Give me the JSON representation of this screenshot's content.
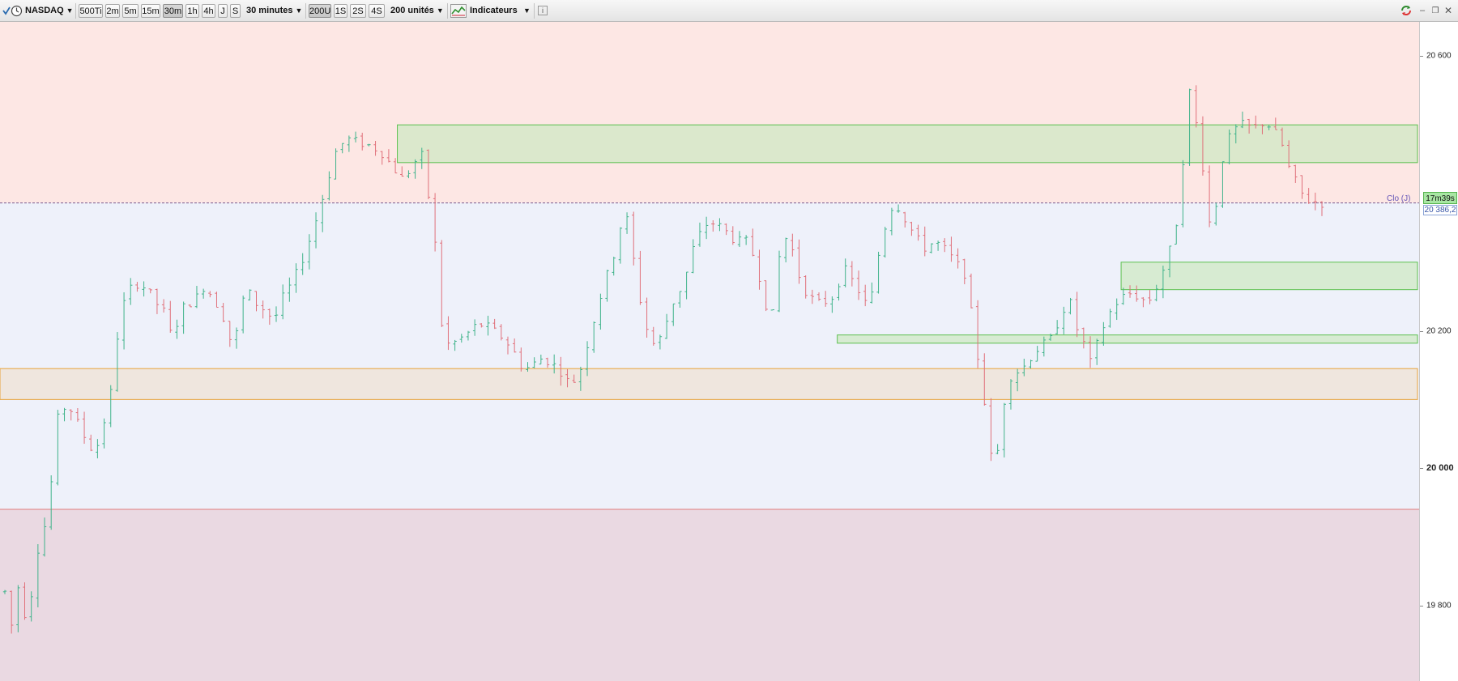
{
  "toolbar": {
    "instrument": "NASDAQ",
    "buttons": [
      "500Ti",
      "2m",
      "5m",
      "15m",
      "30m",
      "1h",
      "4h",
      "J",
      "S"
    ],
    "active_timeframe": "30m",
    "timeframe_select": "30 minutes",
    "range_buttons": [
      "200U",
      "1S",
      "2S",
      "4S"
    ],
    "active_range": "200U",
    "units_select": "200 unités",
    "indicators_label": "Indicateurs",
    "window_controls": [
      "minimize-icon",
      "restore-icon",
      "close-icon"
    ]
  },
  "axis": {
    "ticks": [
      {
        "label": "20 600",
        "value": 20600,
        "bold": false
      },
      {
        "label": "20 200",
        "value": 20200,
        "bold": false
      },
      {
        "label": "20 000",
        "value": 20000,
        "bold": true
      },
      {
        "label": "19 800",
        "value": 19800,
        "bold": false
      }
    ]
  },
  "markers": {
    "close_label": "Clo (J)",
    "timer": "17m39s",
    "last_price": "20 386,2",
    "last_price_value": 20386.2
  },
  "colors": {
    "up_candle": "#3fb38a",
    "down_candle": "#e0707a",
    "zone_green_fill": "#cfe8c4",
    "zone_green_stroke": "#5cc04f",
    "zone_orange_stroke": "#e8a33a",
    "upper_band": "#fde7e4",
    "middle_band": "#eef1fa",
    "lower_band": "#ead9e2",
    "close_line": "#7a5b8f"
  },
  "chart_data": {
    "type": "candlestick",
    "timeframe": "30 minutes",
    "bars_shown": 200,
    "y_range": [
      19690,
      20650
    ],
    "price_path": [
      [
        0,
        19820
      ],
      [
        6,
        19770
      ],
      [
        12,
        19830
      ],
      [
        16,
        19800
      ],
      [
        20,
        19770
      ],
      [
        25,
        19840
      ],
      [
        30,
        19890
      ],
      [
        36,
        19920
      ],
      [
        40,
        19970
      ],
      [
        43,
        20000
      ],
      [
        46,
        20070
      ],
      [
        50,
        20080
      ],
      [
        55,
        20095
      ],
      [
        60,
        20080
      ],
      [
        66,
        20060
      ],
      [
        72,
        20040
      ],
      [
        80,
        20020
      ],
      [
        84,
        20050
      ],
      [
        88,
        20070
      ],
      [
        92,
        20090
      ],
      [
        96,
        20140
      ],
      [
        100,
        20200
      ],
      [
        104,
        20235
      ],
      [
        110,
        20260
      ],
      [
        118,
        20270
      ],
      [
        126,
        20260
      ],
      [
        134,
        20240
      ],
      [
        142,
        20225
      ],
      [
        148,
        20185
      ],
      [
        155,
        20230
      ],
      [
        162,
        20240
      ],
      [
        168,
        20245
      ],
      [
        176,
        20265
      ],
      [
        184,
        20250
      ],
      [
        190,
        20230
      ],
      [
        196,
        20210
      ],
      [
        202,
        20165
      ],
      [
        208,
        20235
      ],
      [
        214,
        20260
      ],
      [
        222,
        20240
      ],
      [
        230,
        20230
      ],
      [
        238,
        20215
      ],
      [
        246,
        20250
      ],
      [
        254,
        20270
      ],
      [
        262,
        20300
      ],
      [
        272,
        20345
      ],
      [
        282,
        20400
      ],
      [
        292,
        20460
      ],
      [
        302,
        20480
      ],
      [
        312,
        20475
      ],
      [
        322,
        20470
      ],
      [
        332,
        20462
      ],
      [
        342,
        20440
      ],
      [
        352,
        20420
      ],
      [
        362,
        20445
      ],
      [
        368,
        20460
      ],
      [
        374,
        20400
      ],
      [
        380,
        20330
      ],
      [
        386,
        20210
      ],
      [
        392,
        20180
      ],
      [
        400,
        20185
      ],
      [
        408,
        20195
      ],
      [
        418,
        20210
      ],
      [
        428,
        20205
      ],
      [
        440,
        20190
      ],
      [
        448,
        20175
      ],
      [
        456,
        20150
      ],
      [
        464,
        20145
      ],
      [
        472,
        20160
      ],
      [
        482,
        20155
      ],
      [
        492,
        20140
      ],
      [
        500,
        20120
      ],
      [
        508,
        20140
      ],
      [
        518,
        20200
      ],
      [
        528,
        20260
      ],
      [
        538,
        20310
      ],
      [
        548,
        20380
      ],
      [
        556,
        20300
      ],
      [
        564,
        20220
      ],
      [
        572,
        20180
      ],
      [
        580,
        20190
      ],
      [
        590,
        20240
      ],
      [
        600,
        20270
      ],
      [
        610,
        20330
      ],
      [
        622,
        20360
      ],
      [
        634,
        20350
      ],
      [
        646,
        20330
      ],
      [
        656,
        20330
      ],
      [
        664,
        20300
      ],
      [
        672,
        20240
      ],
      [
        680,
        20220
      ],
      [
        686,
        20340
      ],
      [
        694,
        20330
      ],
      [
        702,
        20280
      ],
      [
        710,
        20250
      ],
      [
        720,
        20240
      ],
      [
        730,
        20245
      ],
      [
        742,
        20290
      ],
      [
        754,
        20260
      ],
      [
        764,
        20230
      ],
      [
        772,
        20310
      ],
      [
        782,
        20380
      ],
      [
        790,
        20380
      ],
      [
        800,
        20350
      ],
      [
        812,
        20320
      ],
      [
        822,
        20330
      ],
      [
        830,
        20320
      ],
      [
        840,
        20300
      ],
      [
        850,
        20280
      ],
      [
        856,
        20200
      ],
      [
        862,
        20140
      ],
      [
        868,
        20070
      ],
      [
        874,
        19980
      ],
      [
        880,
        20060
      ],
      [
        886,
        20130
      ],
      [
        894,
        20140
      ],
      [
        902,
        20150
      ],
      [
        910,
        20170
      ],
      [
        918,
        20180
      ],
      [
        926,
        20190
      ],
      [
        934,
        20230
      ],
      [
        942,
        20240
      ],
      [
        948,
        20200
      ],
      [
        954,
        20180
      ],
      [
        960,
        20150
      ],
      [
        966,
        20185
      ],
      [
        974,
        20220
      ],
      [
        982,
        20240
      ],
      [
        992,
        20255
      ],
      [
        1002,
        20250
      ],
      [
        1010,
        20240
      ],
      [
        1018,
        20265
      ],
      [
        1026,
        20300
      ],
      [
        1032,
        20330
      ],
      [
        1038,
        20380
      ],
      [
        1044,
        20510
      ],
      [
        1048,
        20560
      ],
      [
        1052,
        20510
      ],
      [
        1058,
        20450
      ],
      [
        1062,
        20390
      ],
      [
        1066,
        20340
      ],
      [
        1070,
        20380
      ],
      [
        1076,
        20450
      ],
      [
        1084,
        20490
      ],
      [
        1094,
        20500
      ],
      [
        1104,
        20495
      ],
      [
        1114,
        20505
      ],
      [
        1122,
        20490
      ],
      [
        1128,
        20475
      ],
      [
        1134,
        20440
      ],
      [
        1140,
        20420
      ],
      [
        1146,
        20400
      ],
      [
        1152,
        20390
      ],
      [
        1158,
        20388
      ],
      [
        1164,
        20386
      ]
    ],
    "horizontal_levels": [
      {
        "name": "close-line",
        "price": 20386.2,
        "style": "dashed"
      },
      {
        "name": "lower-band-line",
        "price": 19940,
        "style": "solid"
      }
    ],
    "zones": [
      {
        "name": "upper-resistance-zone",
        "from_bar": 0.28,
        "to_bar": 1.0,
        "low": 20445,
        "high": 20500,
        "kind": "green"
      },
      {
        "name": "mid-support-zone",
        "from_bar": 0.79,
        "to_bar": 1.0,
        "low": 20260,
        "high": 20300,
        "kind": "green"
      },
      {
        "name": "lower-support-zone",
        "from_bar": 0.59,
        "to_bar": 1.0,
        "low": 20182,
        "high": 20194,
        "kind": "green"
      },
      {
        "name": "demand-zone",
        "from_bar": 0.0,
        "to_bar": 1.0,
        "low": 20100,
        "high": 20145,
        "kind": "orange"
      }
    ],
    "bands": [
      {
        "name": "upper-band",
        "low": 20386.2,
        "high": 20650
      },
      {
        "name": "middle-band",
        "low": 19940,
        "high": 20386.2
      },
      {
        "name": "lower-band",
        "low": 19690,
        "high": 19940
      }
    ]
  }
}
